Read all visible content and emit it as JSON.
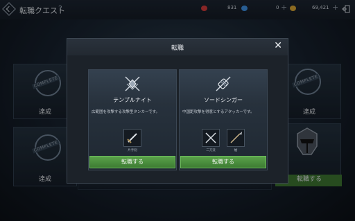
{
  "header": {
    "title": "転職クエスト",
    "help": "?",
    "currency_red": "831",
    "currency_blue": "0",
    "currency_gold": "69,421",
    "plus": "+"
  },
  "background_cards": {
    "completed_label": "達成",
    "stamp": "COMPLETE",
    "bottom_right_button": "転職する"
  },
  "modal": {
    "title": "転職",
    "close": "✕",
    "jobs": [
      {
        "name": "テンプルナイト",
        "description": "広範囲を攻撃する攻撃型タンカーです。",
        "weapons": [
          "片手剣"
        ],
        "button": "転職する"
      },
      {
        "name": "ソードシンガー",
        "description": "中国距攻撃を得意とするアタッカーです。",
        "weapons": [
          "二刀流",
          "槍"
        ],
        "button": "転職する"
      }
    ]
  },
  "colors": {
    "accent_green": "#4f9a40",
    "currency_red": "#d23b3b",
    "currency_blue": "#3e8fe0",
    "currency_gold": "#d6a433"
  }
}
